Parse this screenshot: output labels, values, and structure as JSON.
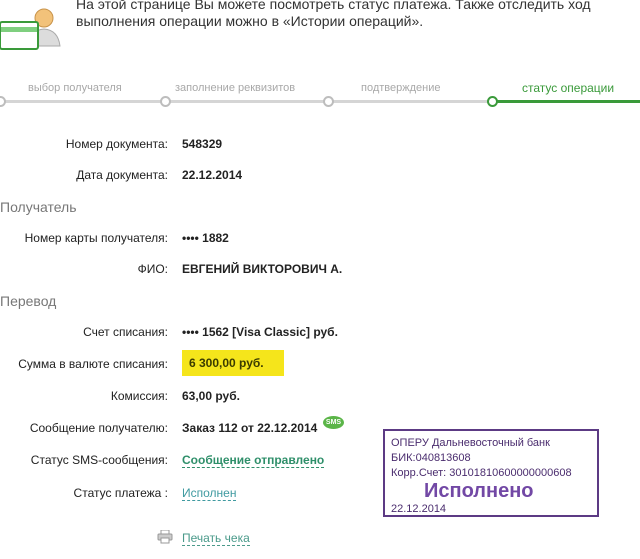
{
  "intro": {
    "line1": "На этой странице Вы можете посмотреть статус платежа. Также отследить ход",
    "line2": "выполнения операции можно в «Истории операций»."
  },
  "steps": [
    {
      "label": "выбор получателя"
    },
    {
      "label": "заполнение реквизитов"
    },
    {
      "label": "подтверждение"
    },
    {
      "label": "статус операции"
    }
  ],
  "document": {
    "number_label": "Номер документа:",
    "number_value": "548329",
    "date_label": "Дата документа:",
    "date_value": "22.12.2014"
  },
  "recipient": {
    "title": "Получатель",
    "card_label": "Номер карты получателя:",
    "card_value": "•••• 1882",
    "name_label": "ФИО:",
    "name_value": "ЕВГЕНИЙ ВИКТОРОВИЧ А."
  },
  "transfer": {
    "title": "Перевод",
    "account_label": "Счет списания:",
    "account_value": "•••• 1562  [Visa Classic]  руб.",
    "amount_label": "Сумма в валюте списания:",
    "amount_value": "6 300,00  руб.",
    "fee_label": "Комиссия:",
    "fee_value": "63,00 руб.",
    "message_label": "Сообщение получателю:",
    "message_value": "Заказ 112 от 22.12.2014",
    "sms_badge": "SMS",
    "sms_status_label": "Статус SMS-сообщения:",
    "sms_status_value": "Сообщение отправлено",
    "payment_status_label": "Статус платежа :",
    "payment_status_value": "Исполнен"
  },
  "stamp": {
    "line1": "ОПЕРУ Дальневосточный банк",
    "line2": "БИК:040813608",
    "line3": "Корр.Счет: 30101810600000000608",
    "status": "Исполнено",
    "date": "22.12.2014"
  },
  "print_label": "Печать чека"
}
